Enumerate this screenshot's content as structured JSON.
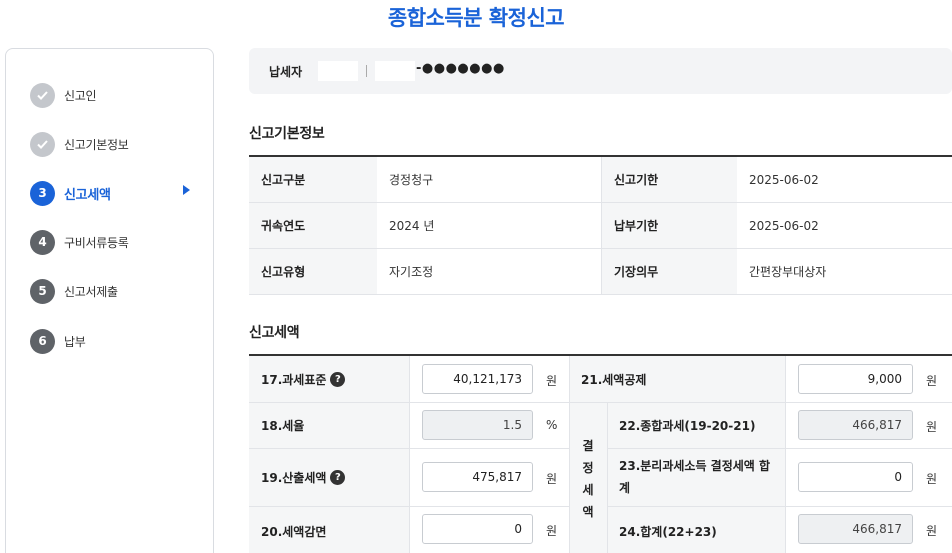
{
  "page": {
    "title": "종합소득분 확정신고"
  },
  "steps": [
    {
      "num": "",
      "label": "신고인",
      "state": "done"
    },
    {
      "num": "",
      "label": "신고기본정보",
      "state": "done"
    },
    {
      "num": "3",
      "label": "신고세액",
      "state": "active"
    },
    {
      "num": "4",
      "label": "구비서류등록",
      "state": "todo"
    },
    {
      "num": "5",
      "label": "신고서제출",
      "state": "todo"
    },
    {
      "num": "6",
      "label": "납부",
      "state": "todo"
    }
  ],
  "taxpayer": {
    "label": "납세자",
    "masked_rrn": "-●●●●●●●"
  },
  "basic_info": {
    "title": "신고기본정보",
    "rows": [
      {
        "k1": "신고구분",
        "v1": "경정청구",
        "k2": "신고기한",
        "v2": "2025-06-02"
      },
      {
        "k1": "귀속연도",
        "v1": "2024 년",
        "k2": "납부기한",
        "v2": "2025-06-02"
      },
      {
        "k1": "신고유형",
        "v1": "자기조정",
        "k2": "기장의무",
        "v2": "간편장부대상자"
      }
    ]
  },
  "tax": {
    "title": "신고세액",
    "r17": {
      "label": "17.과세표준",
      "value": "40,121,173",
      "unit": "원"
    },
    "r18": {
      "label": "18.세율",
      "value": "1.5",
      "unit": "%"
    },
    "r19": {
      "label": "19.산출세액",
      "value": "475,817",
      "unit": "원"
    },
    "r20": {
      "label": "20.세액감면",
      "value": "0",
      "unit": "원"
    },
    "r21": {
      "label": "21.세액공제",
      "value": "9,000",
      "unit": "원"
    },
    "group_label": [
      "결",
      "정",
      "세",
      "액"
    ],
    "r22": {
      "label": "22.종합과세(19-20-21)",
      "value": "466,817",
      "unit": "원"
    },
    "r23": {
      "label_line1": "23.분리과세소득 결정세액 합",
      "label_line2": "계",
      "value": "0",
      "unit": "원"
    },
    "r24": {
      "label": "24.합계(22+23)",
      "value": "466,817",
      "unit": "원"
    },
    "help_icon": "?"
  }
}
